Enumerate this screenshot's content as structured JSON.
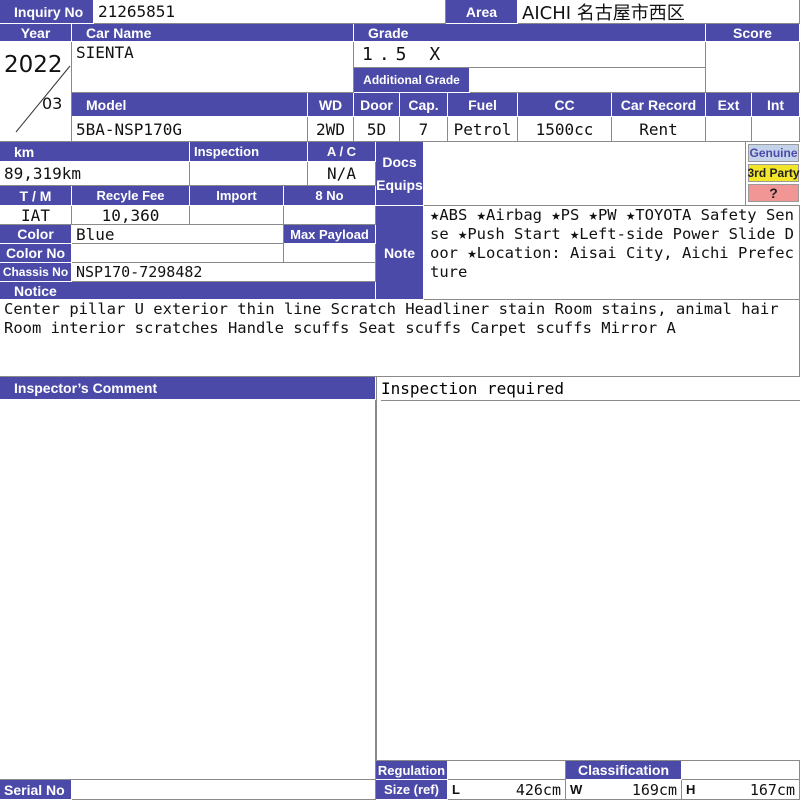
{
  "labels": {
    "inquiry_no": "Inquiry No",
    "area": "Area",
    "year": "Year",
    "car_name": "Car Name",
    "grade": "Grade",
    "score": "Score",
    "additional_grade": "Additional Grade",
    "model": "Model",
    "wd": "WD",
    "door": "Door",
    "cap": "Cap.",
    "fuel": "Fuel",
    "cc": "CC",
    "car_record": "Car Record",
    "ext": "Ext",
    "int": "Int",
    "km": "km",
    "inspection": "Inspection",
    "ac": "A / C",
    "docs": "Docs",
    "equips": "Equips",
    "tm": "T / M",
    "recycle_fee": "Recyle Fee",
    "import": "Import",
    "eight_no": "8 No",
    "color": "Color",
    "max_payload": "Max Payload",
    "color_no": "Color No",
    "note": "Note",
    "chassis_no": "Chassis No",
    "notice": "Notice",
    "inspectors_comment": "Inspector’s Comment",
    "regulation": "Regulation",
    "classification": "Classification",
    "size_ref": "Size (ref)",
    "serial_no": "Serial No",
    "size_l": "L",
    "size_w": "W",
    "size_h": "H"
  },
  "badges": {
    "genuine": "Genuine",
    "third_party": "3rd Party",
    "unknown": "?"
  },
  "colors": {
    "header_bg": "#4b4aa8",
    "genuine_bg": "#c5d3ea",
    "third_party_bg": "#f3e62a",
    "unknown_bg": "#f19595"
  },
  "values": {
    "inquiry_no": "21265851",
    "area": "AICHI 名古屋市西区",
    "year": "2022",
    "month": "03",
    "car_name": "SIENTA",
    "grade": "1.5 X",
    "additional_grade": "",
    "score": "",
    "model": "5BA-NSP170G",
    "wd": "2WD",
    "door": "5D",
    "cap": "7",
    "fuel": "Petrol",
    "cc": "1500cc",
    "car_record": "Rent",
    "ext": "",
    "int": "",
    "km": "89,319km",
    "inspection": "",
    "ac": "N/A",
    "tm": "IAT",
    "recycle_fee": "10,360",
    "import": "",
    "eight_no": "",
    "color": "Blue",
    "max_payload": "",
    "color_no": "",
    "chassis_no": "NSP170-7298482",
    "note": "★ABS ★Airbag ★PS ★PW ★TOYOTA Safety Sense ★Push Start ★Left-side Power Slide Door ★Location: Aisai City, Aichi Prefecture",
    "notice": "Center pillar U exterior thin line Scratch Headliner stain Room stains, animal hair Room interior scratches Handle scuffs Seat scuffs Carpet scuffs Mirror A",
    "inspectors_comment": "",
    "inspection_status": "Inspection required",
    "regulation": "",
    "classification": "",
    "size_l": "426cm",
    "size_w": "169cm",
    "size_h": "167cm",
    "serial_no": ""
  }
}
